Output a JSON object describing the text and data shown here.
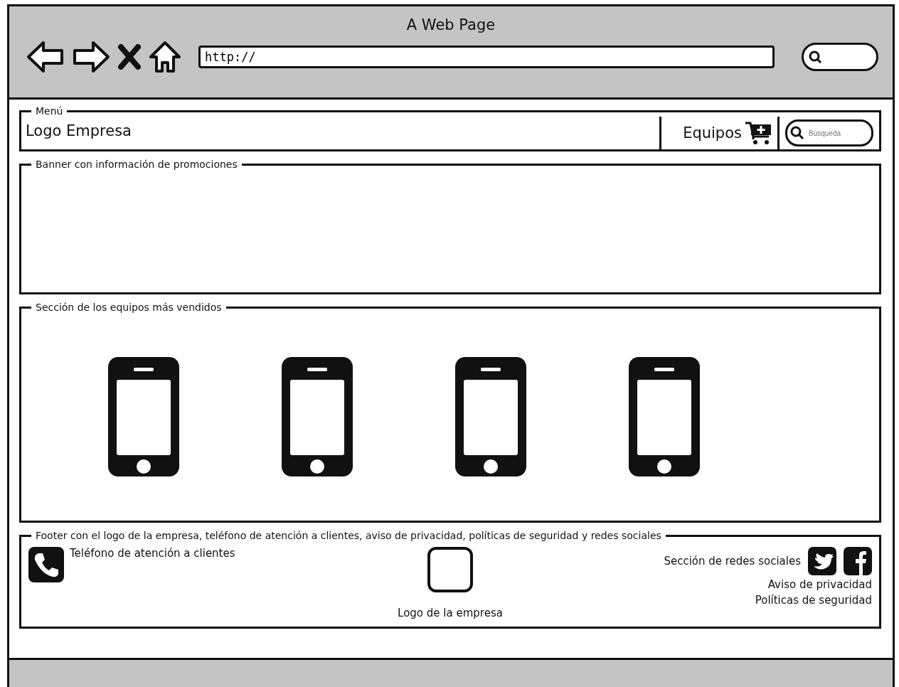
{
  "window": {
    "title": "A Web Page"
  },
  "browser": {
    "address": "http://"
  },
  "menu": {
    "label": "Menú",
    "logo": "Logo Empresa",
    "button": "Equipos",
    "search_placeholder": "Búsqueda"
  },
  "banner": {
    "label": "Banner con información de promociones"
  },
  "products": {
    "label": "Sección de los equipos más vendidos",
    "items": [
      {
        "kind": "phone"
      },
      {
        "kind": "phone"
      },
      {
        "kind": "phone"
      },
      {
        "kind": "phone"
      }
    ]
  },
  "footer": {
    "label": "Footer con el logo de la empresa, teléfono de atención a clientes, aviso de privacidad, políticas de seguridad y redes sociales",
    "phone_text": "Teléfono de atención a clientes",
    "logo_caption": "Logo de la empresa",
    "social_text": "Sección de redes sociales",
    "links": [
      "Aviso de privacidad",
      "Políticas de seguridad"
    ]
  }
}
